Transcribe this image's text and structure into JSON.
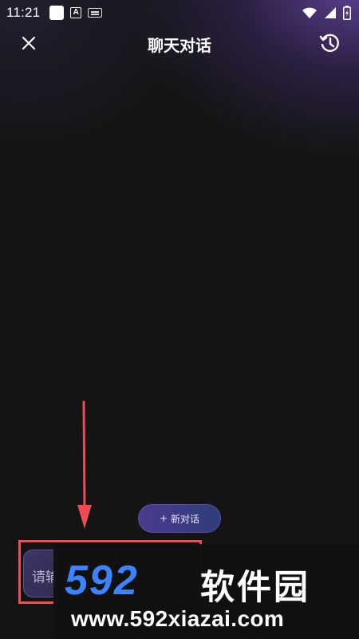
{
  "status_bar": {
    "time": "11:21",
    "left_icons": [
      "app-square-icon",
      "a-icon",
      "keyboard-icon"
    ],
    "right_icons": [
      "wifi-icon",
      "signal-icon",
      "battery-icon"
    ]
  },
  "header": {
    "title": "聊天对话",
    "left_icon": "close-icon",
    "right_icon": "history-icon"
  },
  "new_chat": {
    "plus": "+",
    "label": "新对话"
  },
  "input": {
    "placeholder_visible": "请输"
  },
  "watermark": {
    "digits": "592",
    "site_name": "软件园",
    "url": "www.592xiazai.com"
  },
  "colors": {
    "background": "#141414",
    "accent_purple": "#4b3b8f",
    "highlight_red": "#f14e56",
    "watermark_blue": "#3b83ff"
  }
}
